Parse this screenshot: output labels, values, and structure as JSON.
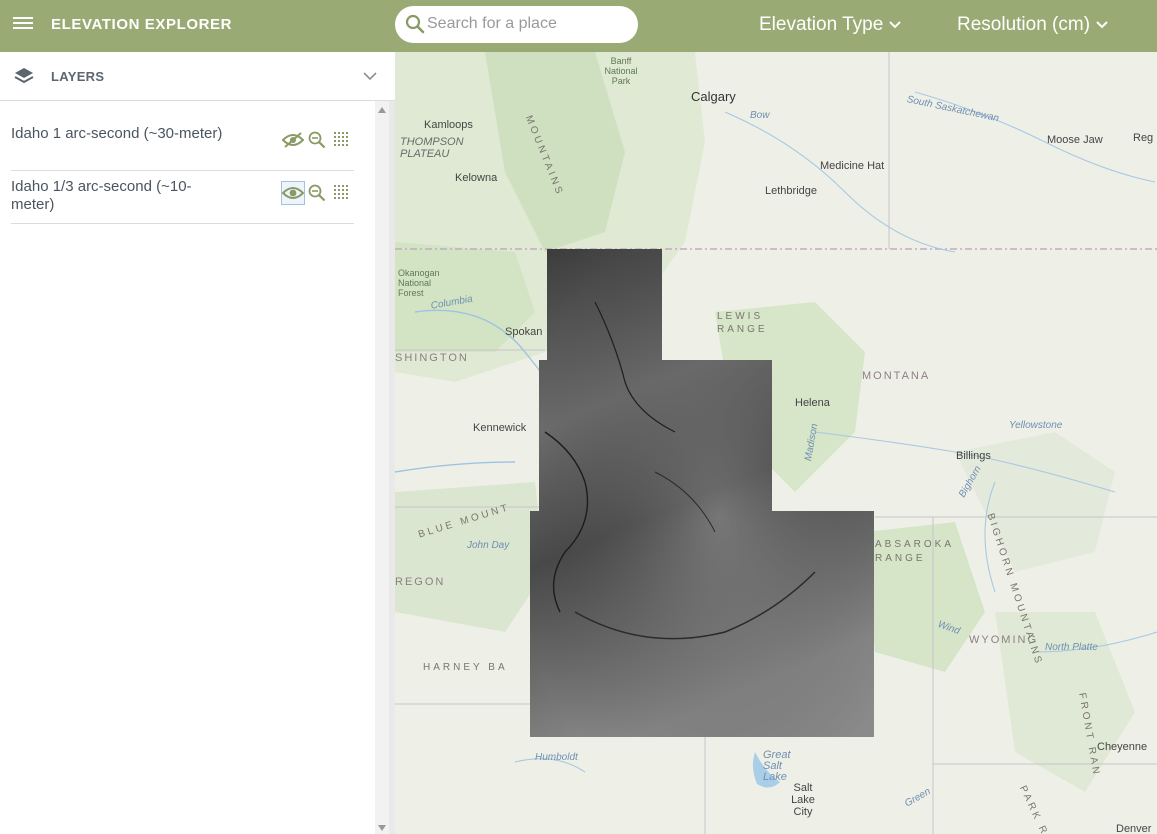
{
  "header": {
    "app_title": "ELEVATION EXPLORER",
    "search_placeholder": "Search for a place",
    "dropdowns": [
      {
        "label": "Elevation Type"
      },
      {
        "label": "Resolution (cm)"
      }
    ],
    "color_bar": "#9aaa74"
  },
  "sidebar": {
    "panel_title": "LAYERS",
    "layers": [
      {
        "name": "Idaho 1 arc-second (~30-meter)",
        "visible": false
      },
      {
        "name": "Idaho 1/3 arc-second (~10-meter)",
        "visible": true
      }
    ]
  },
  "map": {
    "basemap": "topographic",
    "labels": {
      "calgary": "Calgary",
      "kamloops": "Kamloops",
      "kelowna": "Kelowna",
      "lethbridge": "Lethbridge",
      "medicine_hat": "Medicine Hat",
      "moose_jaw": "Moose Jaw",
      "regina": "Reg",
      "spokane": "Spokan",
      "kennewick": "Kennewick",
      "helena": "Helena",
      "billings": "Billings",
      "montana": "MONTANA",
      "washington": "SHINGTON",
      "oregon": "REGON",
      "wyoming": "WYOMING",
      "lewis_range": "LEWIS RANGE",
      "absaroka": "ABSAROKA RANGE",
      "bighorn": "BIGHORN MOUNTAINS",
      "blue_mountains": "BLUE MOUNT",
      "harney": "HARNEY BA",
      "front_range": "FRONT RAN",
      "thompson_plateau": "THOMPSON PLATEAU",
      "okanogan": "Okanogan National Forest",
      "banff": "Banff National Park",
      "great_salt_lake": "Great Salt Lake",
      "salt_lake_city": "Salt Lake City",
      "cheyenne": "Cheyenne",
      "denver": "Denver",
      "bow": "Bow",
      "south_saskatchewan": "South Saskatchewan",
      "yellowstone": "Yellowstone",
      "north_platte": "North Platte",
      "wind": "Wind",
      "columbia": "Columbia",
      "john_day": "John Day",
      "humboldt": "Humboldt",
      "madison": "Madison",
      "green": "Green",
      "park_range": "PARK RA",
      "mountains": "MOUNTAINS",
      "bighorn_river": "Bighorn"
    }
  }
}
